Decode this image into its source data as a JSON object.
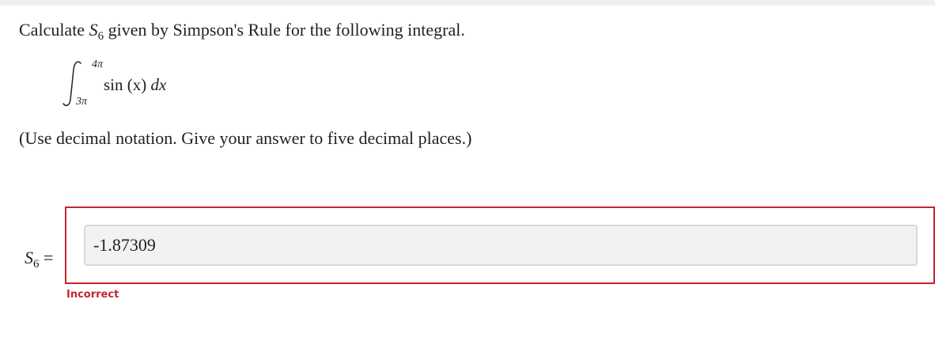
{
  "question": {
    "prefix": "Calculate ",
    "symbol": "S",
    "subscript": "6",
    "suffix": " given by Simpson's Rule for the following integral."
  },
  "integral": {
    "upper_limit": "4π",
    "lower_limit": "3π",
    "function": "sin",
    "argument": "(x)",
    "differential": "dx"
  },
  "instruction": "(Use decimal notation. Give your answer to five decimal places.)",
  "answer": {
    "label_symbol": "S",
    "label_subscript": "6",
    "equals": "=",
    "value": "-1.87309",
    "status": "Incorrect"
  },
  "colors": {
    "error": "#c1272d",
    "field_background": "#f2f2f2"
  }
}
